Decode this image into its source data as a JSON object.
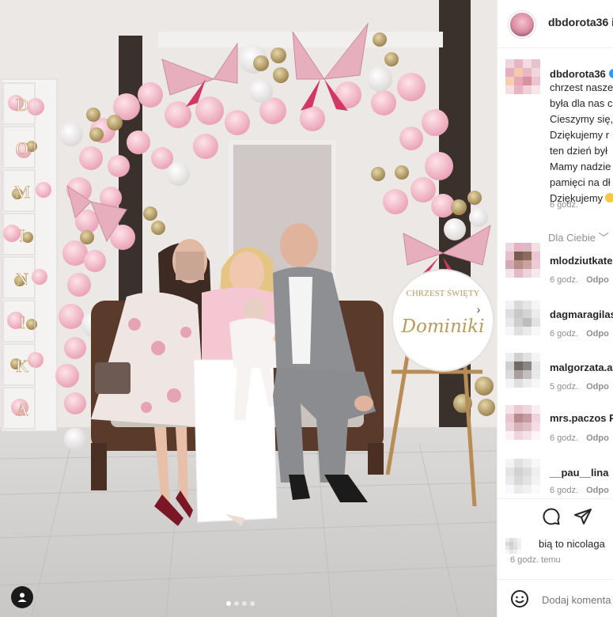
{
  "post": {
    "username": "dbdorota36",
    "header_suffix": "i",
    "photo_icons": {
      "user_tag": "person-icon",
      "next": "chevron-right-icon"
    },
    "carousel": {
      "count": 4,
      "active": 0
    }
  },
  "photo_text": {
    "letters": [
      "D",
      "O",
      "M",
      "I",
      "N",
      "I",
      "K",
      "A"
    ],
    "sign_top": "CHRZEST ŚWIĘTY",
    "sign_name": "Dominiki"
  },
  "caption": {
    "username": "dbdorota36",
    "lines": [
      "chrzest nasze",
      "była dla nas c",
      "Cieszymy się,",
      "Dziękujemy r",
      "ten dzień był",
      "Mamy nadzie",
      "pamięci na dł",
      "Dziękujemy"
    ],
    "time": "6 godz."
  },
  "sort": {
    "label": "Dla Ciebie",
    "icon": "chevron-down-icon"
  },
  "comments": [
    {
      "user": "mlodziutkate",
      "time": "6 godz.",
      "reply": "Odpo"
    },
    {
      "user": "dagmaragilas",
      "time": "6 godz.",
      "reply": "Odpo"
    },
    {
      "user": "malgorzata.a",
      "time": "5 godz.",
      "reply": "Odpo"
    },
    {
      "user": "mrs.paczos P",
      "time": "6 godz.",
      "reply": "Odpo"
    },
    {
      "user": "__pau__lina",
      "time": "6 godz.",
      "reply": "Odpo"
    }
  ],
  "actions": {
    "comment": "comment-icon",
    "share": "share-icon"
  },
  "likes": {
    "text": "bią to nicolaga"
  },
  "posted_ago": "6 godz. temu",
  "add_comment": {
    "placeholder": "Dodaj komenta",
    "icon": "smiley-icon"
  },
  "colors": {
    "accent": "#3897f0",
    "pink": "#f3b7c6",
    "gold": "#b89b5e"
  }
}
